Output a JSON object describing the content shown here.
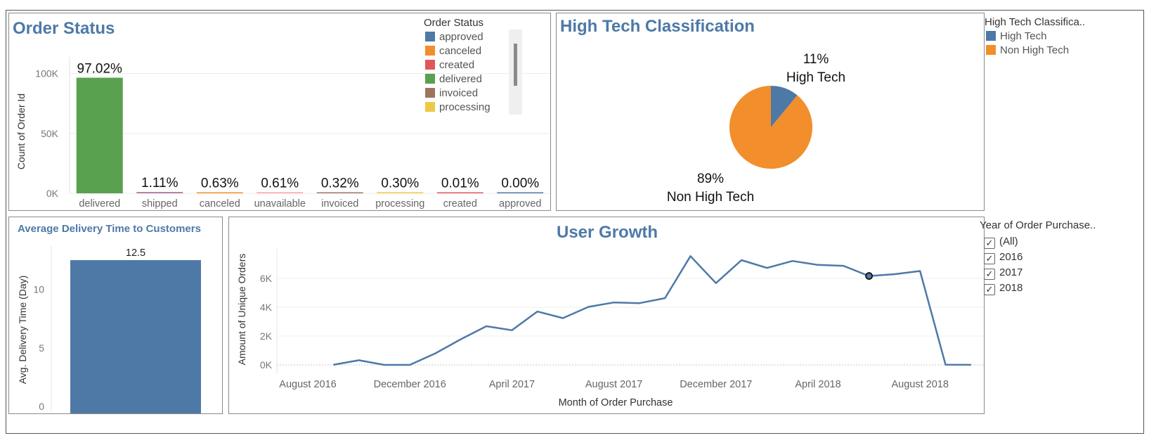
{
  "order_status": {
    "title": "Order Status",
    "legend_title": "Order Status",
    "legend": [
      {
        "label": "approved",
        "color": "#4e79a7"
      },
      {
        "label": "canceled",
        "color": "#f28e2b"
      },
      {
        "label": "created",
        "color": "#e15759"
      },
      {
        "label": "delivered",
        "color": "#59a14f"
      },
      {
        "label": "invoiced",
        "color": "#9c755f"
      },
      {
        "label": "processing",
        "color": "#edc948"
      }
    ]
  },
  "high_tech": {
    "title": "High Tech Classification",
    "legend_title": "High Tech Classifica..",
    "legend": [
      {
        "label": "High Tech",
        "color": "#4e79a7"
      },
      {
        "label": "Non High Tech",
        "color": "#f28e2b"
      }
    ]
  },
  "delivery": {
    "title": "Average Delivery Time to Customers"
  },
  "growth": {
    "title": "User Growth"
  },
  "year_filter": {
    "title": "Year of Order Purchase..",
    "options": [
      {
        "label": "(All)",
        "checked": true
      },
      {
        "label": "2016",
        "checked": true
      },
      {
        "label": "2017",
        "checked": true
      },
      {
        "label": "2018",
        "checked": true
      }
    ]
  },
  "chart_data": [
    {
      "type": "bar",
      "title": "Order Status",
      "ylabel": "Count of Order Id",
      "xlabel": "",
      "ylim": [
        0,
        105000
      ],
      "yticks": [
        {
          "value": 0,
          "label": "0K"
        },
        {
          "value": 50000,
          "label": "50K"
        },
        {
          "value": 100000,
          "label": "100K"
        }
      ],
      "categories": [
        "delivered",
        "shipped",
        "canceled",
        "unavailable",
        "invoiced",
        "processing",
        "created",
        "approved"
      ],
      "values": [
        96478,
        1107,
        625,
        609,
        314,
        301,
        5,
        2
      ],
      "labels": [
        "97.02%",
        "1.11%",
        "0.63%",
        "0.61%",
        "0.32%",
        "0.30%",
        "0.01%",
        "0.00%"
      ],
      "colors": [
        "#59a14f",
        "#b07aa1",
        "#f28e2b",
        "#ff9da7",
        "#9c755f",
        "#edc948",
        "#e15759",
        "#4e79a7"
      ],
      "grid": true
    },
    {
      "type": "pie",
      "title": "High Tech Classification",
      "slices": [
        {
          "label": "High Tech",
          "value": 11,
          "text": "11%",
          "color": "#4e79a7"
        },
        {
          "label": "Non High Tech",
          "value": 89,
          "text": "89%",
          "color": "#f28e2b"
        }
      ]
    },
    {
      "type": "bar",
      "title": "Average Delivery Time to Customers",
      "ylabel": "Avg. Delivery Time (Day)",
      "ylim": [
        0,
        14
      ],
      "yticks": [
        0,
        5,
        10
      ],
      "categories": [
        ""
      ],
      "values": [
        12.5
      ],
      "labels": [
        "12.5"
      ],
      "color": "#4e79a7"
    },
    {
      "type": "line",
      "title": "User Growth",
      "xlabel": "Month of Order Purchase",
      "ylabel": "Amount of Unique Orders",
      "ylim": [
        -200,
        7200
      ],
      "yticks": [
        {
          "value": 0,
          "label": "0K"
        },
        {
          "value": 2000,
          "label": "2K"
        },
        {
          "value": 4000,
          "label": "4K"
        },
        {
          "value": 6000,
          "label": "6K"
        }
      ],
      "x": [
        "2016-09",
        "2016-10",
        "2016-11",
        "2016-12",
        "2017-01",
        "2017-02",
        "2017-03",
        "2017-04",
        "2017-05",
        "2017-06",
        "2017-07",
        "2017-08",
        "2017-09",
        "2017-10",
        "2017-11",
        "2017-12",
        "2018-01",
        "2018-02",
        "2018-03",
        "2018-04",
        "2018-05",
        "2018-06",
        "2018-07",
        "2018-08",
        "2018-09",
        "2018-10"
      ],
      "xticks": [
        {
          "x": "2016-08",
          "label": "August 2016"
        },
        {
          "x": "2016-12",
          "label": "December 2016"
        },
        {
          "x": "2017-04",
          "label": "April 2017"
        },
        {
          "x": "2017-08",
          "label": "August 2017"
        },
        {
          "x": "2017-12",
          "label": "December 2017"
        },
        {
          "x": "2018-04",
          "label": "April 2018"
        },
        {
          "x": "2018-08",
          "label": "August 2018"
        }
      ],
      "series": [
        {
          "color": "#4e79a7",
          "values": [
            4,
            324,
            0,
            1,
            800,
            1780,
            2682,
            2404,
            3700,
            3245,
            4026,
            4331,
            4285,
            4631,
            7544,
            5673,
            7269,
            6728,
            7211,
            6939,
            6873,
            6167,
            6292,
            6512,
            16,
            4
          ]
        }
      ],
      "highlight": "2018-06",
      "grid": true
    }
  ]
}
